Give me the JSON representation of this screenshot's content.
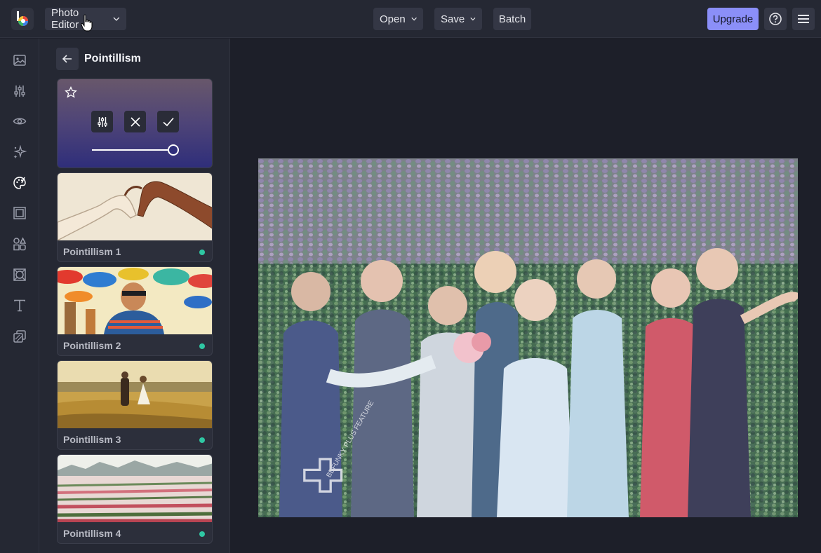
{
  "topbar": {
    "app_menu_label": "Photo Editor",
    "open_label": "Open",
    "save_label": "Save",
    "batch_label": "Batch",
    "upgrade_label": "Upgrade",
    "accent_color": "#8b8ff8"
  },
  "rail": {
    "items": [
      "image-icon",
      "sliders-icon",
      "eye-icon",
      "sparkles-icon",
      "palette-icon",
      "frame-icon",
      "shapes-icon",
      "overlay-icon",
      "text-icon",
      "layers-icon"
    ],
    "active": "palette-icon"
  },
  "panel": {
    "title": "Pointillism",
    "active_preset": {
      "intensity": 1.0
    },
    "presets": [
      {
        "label": "Pointillism 1"
      },
      {
        "label": "Pointillism 2"
      },
      {
        "label": "Pointillism 3"
      },
      {
        "label": "Pointillism 4"
      }
    ]
  },
  "watermark": "BEFUNKY PLUS FEATURE"
}
